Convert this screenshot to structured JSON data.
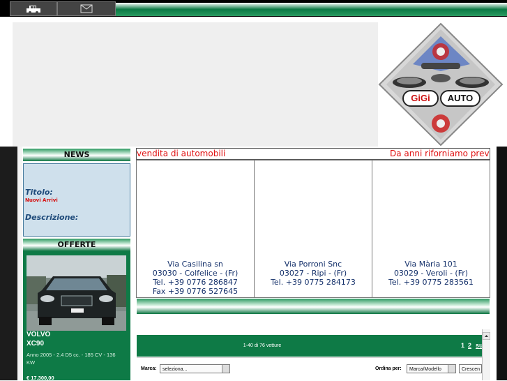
{
  "topbar": {
    "icons": [
      "car-icon",
      "mail-icon"
    ]
  },
  "news": {
    "header": "NEWS",
    "titolo_label": "Titolo:",
    "titolo_value": "Nuovi Arrivi",
    "descrizione_label": "Descrizione:"
  },
  "offerte": {
    "header": "OFFERTE",
    "car_make": "VOLVO",
    "car_model": "XC90",
    "car_details": "Anno 2005 - 2.4 D5 cc. - 185 CV - 136 KW",
    "car_price": "€ 17.300,00"
  },
  "ticker": {
    "left_text": "vendita di automobili",
    "right_text": "Da anni riforniamo previ"
  },
  "addresses": [
    {
      "street": "Via Casilina sn",
      "city": "03030 - Colfelice - (Fr)",
      "tel": "Tel. +39 0776 286847",
      "fax": "Fax +39 0776 527645"
    },
    {
      "street": "Via Porroni Snc",
      "city": "03027 - Ripi - (Fr)",
      "tel": "Tel. +39 0775 284173"
    },
    {
      "street": "Via Mària 101",
      "city": "03029 - Veroli - (Fr)",
      "tel": "Tel. +39 0775 283561"
    }
  ],
  "pager": {
    "count_text": "1-40 di 76 vetture",
    "page1": "1",
    "page2": "2",
    "next": "su"
  },
  "filters": {
    "marca_label": "Marca:",
    "marca_value": "seleziona...",
    "ordina_label": "Ordina per:",
    "ordina_value": "Marca/Modello",
    "order_value": "Crescen"
  },
  "logo": {
    "brand_left": "GiGi",
    "brand_right": "AUTO"
  },
  "colors": {
    "accent_green": "#0e7a46",
    "ticker_red": "#e01010",
    "news_bg": "#cfe0ec"
  }
}
